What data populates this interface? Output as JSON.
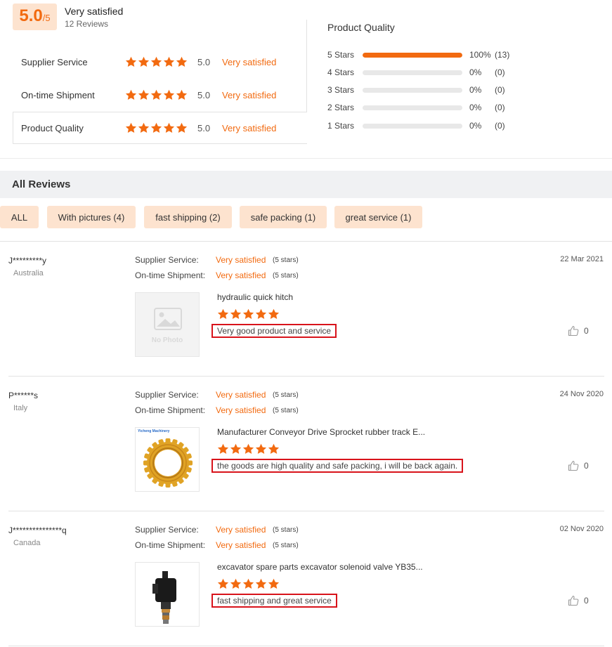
{
  "summary": {
    "score": "5.0",
    "score_of": "/5",
    "overall_text": "Very satisfied",
    "review_count": "12 Reviews",
    "ratings": [
      {
        "label": "Supplier Service",
        "score": "5.0",
        "text": "Very satisfied"
      },
      {
        "label": "On-time Shipment",
        "score": "5.0",
        "text": "Very satisfied"
      },
      {
        "label": "Product Quality",
        "score": "5.0",
        "text": "Very satisfied"
      }
    ]
  },
  "product_quality": {
    "title": "Product Quality",
    "rows": [
      {
        "label": "5 Stars",
        "pct": "100%",
        "count": "(13)",
        "fill": 1.0
      },
      {
        "label": "4 Stars",
        "pct": "0%",
        "count": "(0)",
        "fill": 0
      },
      {
        "label": "3 Stars",
        "pct": "0%",
        "count": "(0)",
        "fill": 0
      },
      {
        "label": "2 Stars",
        "pct": "0%",
        "count": "(0)",
        "fill": 0
      },
      {
        "label": "1 Stars",
        "pct": "0%",
        "count": "(0)",
        "fill": 0
      }
    ]
  },
  "all_reviews": {
    "title": "All Reviews",
    "filters": [
      "ALL",
      "With pictures (4)",
      "fast shipping (2)",
      "safe packing (1)",
      "great service (1)"
    ]
  },
  "reviews": [
    {
      "name": "J*********y",
      "country": "Australia",
      "date": "22 Mar 2021",
      "supplier_label": "Supplier Service:",
      "supplier_value": "Very satisfied",
      "supplier_stars": "(5 stars)",
      "shipment_label": "On-time Shipment:",
      "shipment_value": "Very satisfied",
      "shipment_stars": "(5 stars)",
      "product": "hydraulic quick hitch",
      "comment": "Very good product and service",
      "likes": "0",
      "image": "no-photo-icon",
      "image_text": "No Photo"
    },
    {
      "name": "P******s",
      "country": "Italy",
      "date": "24 Nov 2020",
      "supplier_label": "Supplier Service:",
      "supplier_value": "Very satisfied",
      "supplier_stars": "(5 stars)",
      "shipment_label": "On-time Shipment:",
      "shipment_value": "Very satisfied",
      "shipment_stars": "(5 stars)",
      "product": "Manufacturer Conveyor Drive Sprocket rubber track E...",
      "comment": "the goods are high quality and safe packing, i will be back again.",
      "likes": "0",
      "image": "sprocket-photo",
      "image_text": "Yicheng Machinery"
    },
    {
      "name": "J***************q",
      "country": "Canada",
      "date": "02 Nov 2020",
      "supplier_label": "Supplier Service:",
      "supplier_value": "Very satisfied",
      "supplier_stars": "(5 stars)",
      "shipment_label": "On-time Shipment:",
      "shipment_value": "Very satisfied",
      "shipment_stars": "(5 stars)",
      "product": "excavator spare parts excavator solenoid valve YB35...",
      "comment": "fast shipping and great service",
      "likes": "0",
      "image": "solenoid-valve-photo"
    }
  ],
  "colors": {
    "accent": "#f26a10",
    "chip_bg": "#fde3cf",
    "highlight_border": "#d8131b"
  }
}
